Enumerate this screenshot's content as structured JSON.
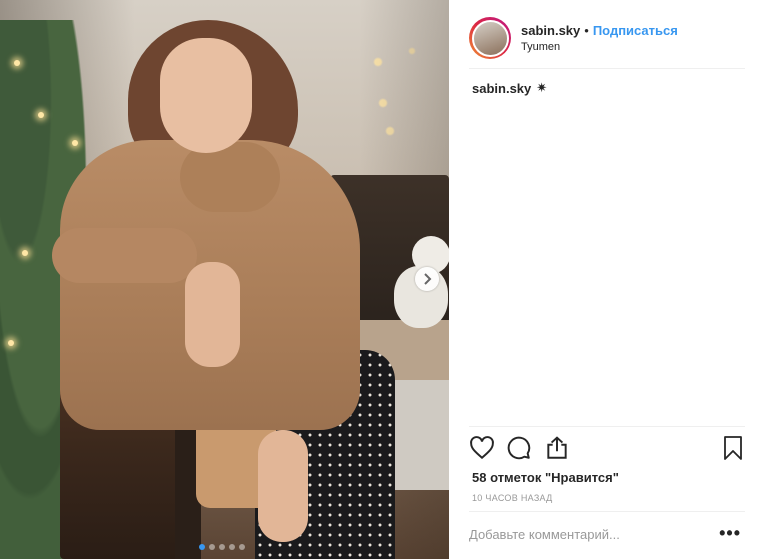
{
  "post": {
    "username": "sabin.sky",
    "separator": "•",
    "follow_label": "Подписаться",
    "location": "Tyumen",
    "caption_username": "sabin.sky",
    "caption_emoji": "✷",
    "likes_text": "58 отметок \"Нравится\"",
    "time_text": "10 ЧАСОВ НАЗАД",
    "comment_placeholder": "Добавьте комментарий...",
    "more_label": "•••"
  },
  "icons": {
    "like": "heart-icon",
    "comment": "comment-icon",
    "share": "share-icon",
    "save": "bookmark-icon",
    "next": "chevron-right-icon"
  },
  "carousel": {
    "total_slides": 5,
    "active_slide": 1
  },
  "colors": {
    "link": "#3897f0",
    "text": "#262626",
    "muted": "#999999",
    "divider": "#efefef"
  }
}
